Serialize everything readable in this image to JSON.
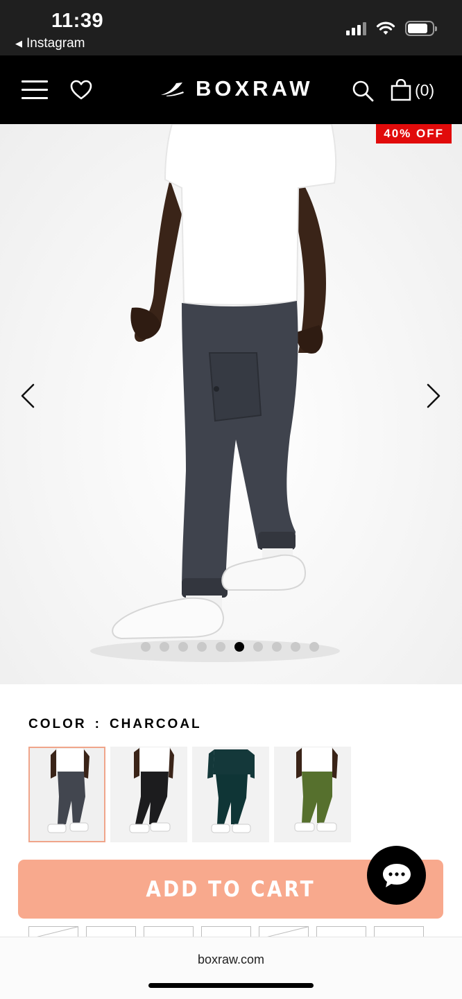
{
  "status_bar": {
    "time": "11:39",
    "back_app": "Instagram",
    "icons": [
      "cellular-signal-icon",
      "wifi-icon",
      "battery-icon"
    ]
  },
  "header": {
    "brand": "BOXRAW",
    "cart_count": "(0)",
    "icons": [
      "menu-icon",
      "heart-icon",
      "search-icon",
      "shopping-bag-icon"
    ],
    "background": "#000000"
  },
  "product": {
    "discount_badge": "40% OFF",
    "badge_color": "#e10b0b",
    "gallery_total": 10,
    "gallery_active_index": 5
  },
  "color_selector": {
    "label": "COLOR",
    "separator": ":",
    "selected": "CHARCOAL",
    "swatch_count": 4,
    "selected_index": 0
  },
  "actions": {
    "add_to_cart": "ADD TO CART",
    "add_to_cart_color": "#f8a98d"
  },
  "browser": {
    "domain": "boxraw.com"
  }
}
